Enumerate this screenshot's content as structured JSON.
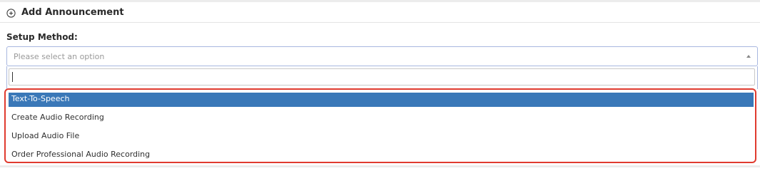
{
  "section": {
    "title": "Add Announcement",
    "icon": "plus-circle-icon"
  },
  "setup_method": {
    "label": "Setup Method:",
    "placeholder": "Please select an option",
    "search_value": "",
    "options": [
      {
        "label": "Text-To-Speech",
        "selected": true
      },
      {
        "label": "Create Audio Recording",
        "selected": false
      },
      {
        "label": "Upload Audio File",
        "selected": false
      },
      {
        "label": "Order Professional Audio Recording",
        "selected": false
      }
    ]
  },
  "colors": {
    "selected_option_bg": "#3a78b8",
    "highlight_border": "#e03b2f",
    "select_border": "#a8b7e0"
  }
}
